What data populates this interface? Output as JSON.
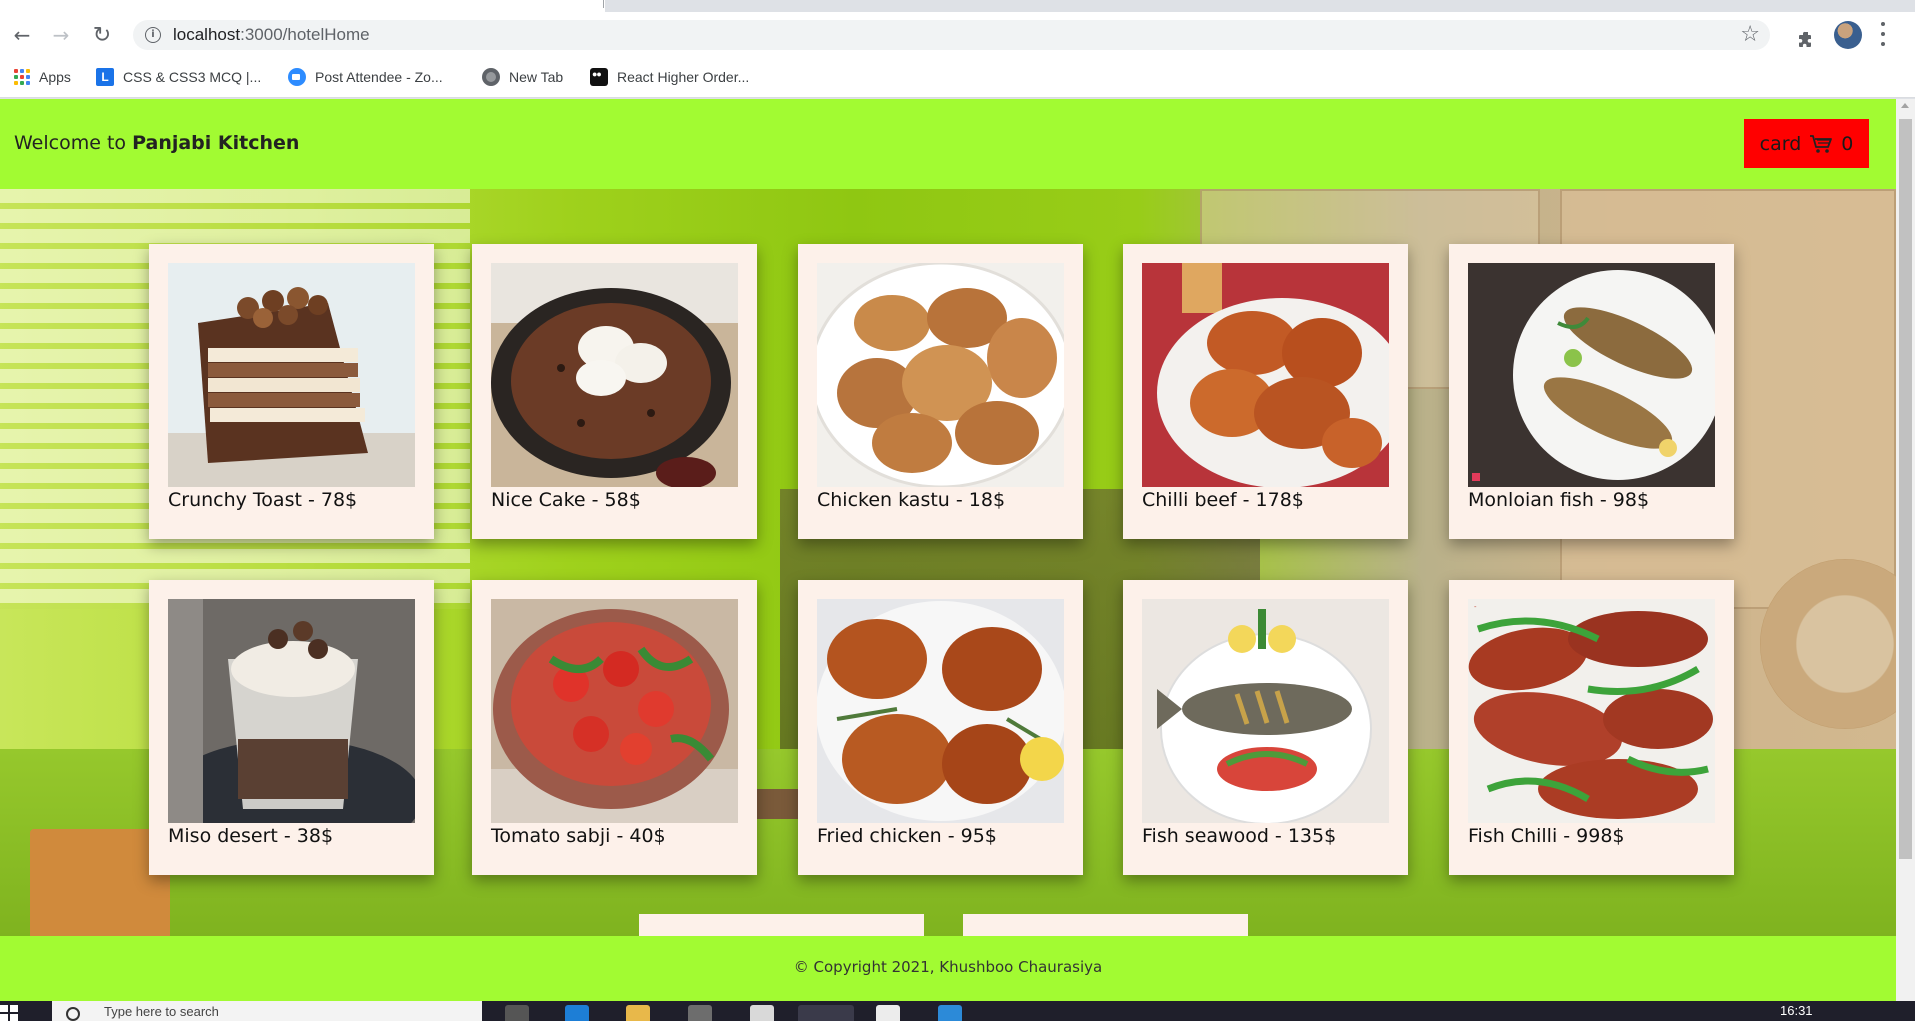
{
  "browser": {
    "url_host": "localhost",
    "url_rest": ":3000/hotelHome",
    "bookmarks": [
      {
        "label": "Apps",
        "icon": "apps-grid-icon"
      },
      {
        "label": "CSS & CSS3 MCQ |...",
        "icon": "l-favicon"
      },
      {
        "label": "Post Attendee - Zo...",
        "icon": "zoom-favicon"
      },
      {
        "label": "New Tab",
        "icon": "globe-icon"
      },
      {
        "label": "React Higher Order...",
        "icon": "medium-favicon"
      }
    ]
  },
  "header": {
    "welcome": "Welcome to ",
    "brand": "Panjabi Kitchen",
    "cart_label": "card",
    "cart_count": "0",
    "accent_color": "#a2fb32",
    "cart_color": "#ff0000"
  },
  "menu": [
    {
      "label": "Crunchy Toast - 78$",
      "image": "layered-chocolate-cake"
    },
    {
      "label": "Nice Cake - 58$",
      "image": "skillet-cookie-ice-cream"
    },
    {
      "label": "Chicken kastu - 18$",
      "image": "fried-chicken-plate"
    },
    {
      "label": "Chilli beef - 178$",
      "image": "fried-pieces-plate"
    },
    {
      "label": "Monloian fish - 98$",
      "image": "grilled-fish-plate"
    },
    {
      "label": "Miso desert - 38$",
      "image": "dessert-cups"
    },
    {
      "label": "Tomato sabji - 40$",
      "image": "tomato-salad-bowl"
    },
    {
      "label": "Fried chicken - 95$",
      "image": "fried-chicken-lemon"
    },
    {
      "label": "Fish seawood - 135$",
      "image": "fish-seafood-plate"
    },
    {
      "label": "Fish Chilli - 998$",
      "image": "red-fish-fry-chillies"
    }
  ],
  "footer": {
    "copyright": "© Copyright 2021, Khushboo Chaurasiya"
  },
  "taskbar": {
    "search_placeholder": "Type here to search",
    "clock": "16:31"
  }
}
